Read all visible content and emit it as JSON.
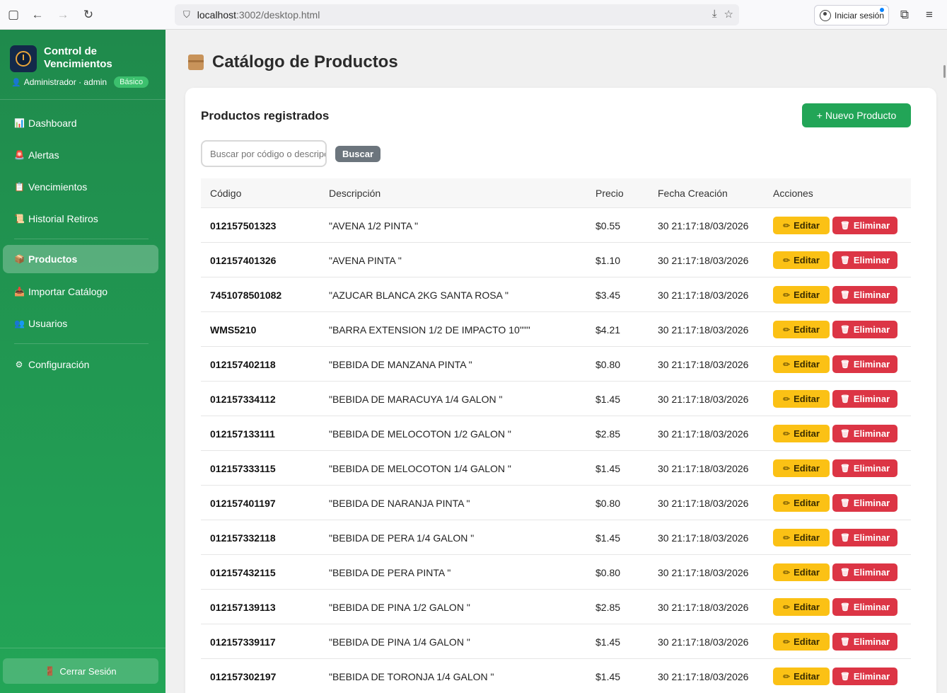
{
  "browser": {
    "url_host": "localhost",
    "url_rest": ":3002/desktop.html",
    "signin_label": "Iniciar sesión"
  },
  "sidebar": {
    "brand_title": "Control de Vencimientos",
    "user": "Administrador · admin",
    "plan": "Básico",
    "items": [
      {
        "label": "Dashboard",
        "icon": "bar-chart-icon"
      },
      {
        "label": "Alertas",
        "icon": "alert-icon"
      },
      {
        "label": "Vencimientos",
        "icon": "clipboard-icon"
      },
      {
        "label": "Historial Retiros",
        "icon": "scroll-icon"
      },
      {
        "label": "Productos",
        "icon": "package-icon"
      },
      {
        "label": "Importar Catálogo",
        "icon": "inbox-icon"
      },
      {
        "label": "Usuarios",
        "icon": "users-icon"
      },
      {
        "label": "Configuración",
        "icon": "gear-icon"
      }
    ],
    "logout_label": "Cerrar Sesión"
  },
  "main": {
    "page_title": "Catálogo de Productos",
    "card_title": "Productos registrados",
    "new_product_label": "+ Nuevo Producto",
    "search_placeholder": "Buscar por código o descripción",
    "search_button": "Buscar"
  },
  "table": {
    "headers": [
      "Código",
      "Descripción",
      "Precio",
      "Fecha Creación",
      "Acciones"
    ],
    "edit_label": "Editar",
    "delete_label": "Eliminar",
    "rows": [
      {
        "code": "012157501323",
        "description": "\"AVENA 1/2 PINTA \"",
        "price": "$0.55",
        "date": "30 21:17:18/03/2026"
      },
      {
        "code": "012157401326",
        "description": "\"AVENA PINTA \"",
        "price": "$1.10",
        "date": "30 21:17:18/03/2026"
      },
      {
        "code": "7451078501082",
        "description": "\"AZUCAR BLANCA 2KG SANTA ROSA \"",
        "price": "$3.45",
        "date": "30 21:17:18/03/2026"
      },
      {
        "code": "WMS5210",
        "description": "\"BARRA EXTENSION 1/2 DE IMPACTO 10\"\"\"",
        "price": "$4.21",
        "date": "30 21:17:18/03/2026"
      },
      {
        "code": "012157402118",
        "description": "\"BEBIDA DE MANZANA PINTA \"",
        "price": "$0.80",
        "date": "30 21:17:18/03/2026"
      },
      {
        "code": "012157334112",
        "description": "\"BEBIDA DE MARACUYA 1/4 GALON \"",
        "price": "$1.45",
        "date": "30 21:17:18/03/2026"
      },
      {
        "code": "012157133111",
        "description": "\"BEBIDA DE MELOCOTON 1/2 GALON \"",
        "price": "$2.85",
        "date": "30 21:17:18/03/2026"
      },
      {
        "code": "012157333115",
        "description": "\"BEBIDA DE MELOCOTON 1/4 GALON \"",
        "price": "$1.45",
        "date": "30 21:17:18/03/2026"
      },
      {
        "code": "012157401197",
        "description": "\"BEBIDA DE NARANJA PINTA \"",
        "price": "$0.80",
        "date": "30 21:17:18/03/2026"
      },
      {
        "code": "012157332118",
        "description": "\"BEBIDA DE PERA 1/4 GALON \"",
        "price": "$1.45",
        "date": "30 21:17:18/03/2026"
      },
      {
        "code": "012157432115",
        "description": "\"BEBIDA DE PERA PINTA \"",
        "price": "$0.80",
        "date": "30 21:17:18/03/2026"
      },
      {
        "code": "012157139113",
        "description": "\"BEBIDA DE PINA 1/2 GALON \"",
        "price": "$2.85",
        "date": "30 21:17:18/03/2026"
      },
      {
        "code": "012157339117",
        "description": "\"BEBIDA DE PINA 1/4 GALON \"",
        "price": "$1.45",
        "date": "30 21:17:18/03/2026"
      },
      {
        "code": "012157302197",
        "description": "\"BEBIDA DE TORONJA 1/4 GALON \"",
        "price": "$1.45",
        "date": "30 21:17:18/03/2026"
      }
    ]
  }
}
